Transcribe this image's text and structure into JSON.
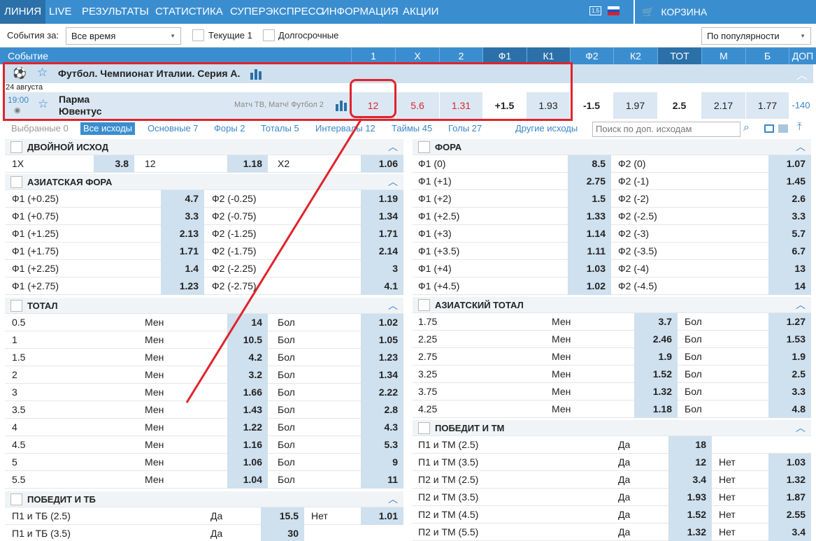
{
  "nav": {
    "items": [
      "ЛИНИЯ",
      "LIVE",
      "РЕЗУЛЬТАТЫ",
      "СТАТИСТИКА",
      "СУПЕРЭКСПРЕСС",
      "ИНФОРМАЦИЯ",
      "АКЦИИ"
    ],
    "lang": "1.5",
    "cart": "КОРЗИНА"
  },
  "filters": {
    "events_label": "События за:",
    "period": "Все время",
    "current": "Текущие 1",
    "longterm": "Долгосрочные",
    "sort": "По популярности"
  },
  "columns": [
    "Событие",
    "1",
    "X",
    "2",
    "Ф1",
    "К1",
    "Ф2",
    "К2",
    "ТОТ",
    "М",
    "Б",
    "ДОП"
  ],
  "league": "Футбол. Чемпионат Италии. Серия А.",
  "date": "24 августа",
  "match": {
    "time": "19:00",
    "team1": "Парма",
    "team2": "Ювентус",
    "tv": "Матч ТВ, Матч! Футбол 2",
    "odds": [
      "12",
      "5.6",
      "1.31",
      "+1.5",
      "1.93",
      "-1.5",
      "1.97",
      "2.5",
      "2.17",
      "1.77",
      "-140"
    ]
  },
  "tabs": [
    "Выбранные 0",
    "Все исходы",
    "Основные 7",
    "Форы 2",
    "Тоталы 5",
    "Интервалы 12",
    "Таймы 45",
    "Голы 27",
    "Другие исходы"
  ],
  "search_placeholder": "Поиск по доп. исходам",
  "markets": {
    "double": {
      "title": "ДВОЙНОЙ ИСХОД",
      "items": [
        [
          "1X",
          "3.8"
        ],
        [
          "12",
          "1.18"
        ],
        [
          "X2",
          "1.06"
        ]
      ]
    },
    "asian_hc": {
      "title": "АЗИАТСКАЯ ФОРА",
      "rows": [
        [
          "Ф1 (+0.25)",
          "4.7",
          "Ф2 (-0.25)",
          "1.19"
        ],
        [
          "Ф1 (+0.75)",
          "3.3",
          "Ф2 (-0.75)",
          "1.34"
        ],
        [
          "Ф1 (+1.25)",
          "2.13",
          "Ф2 (-1.25)",
          "1.71"
        ],
        [
          "Ф1 (+1.75)",
          "1.71",
          "Ф2 (-1.75)",
          "2.14"
        ],
        [
          "Ф1 (+2.25)",
          "1.4",
          "Ф2 (-2.25)",
          "3"
        ],
        [
          "Ф1 (+2.75)",
          "1.23",
          "Ф2 (-2.75)",
          "4.1"
        ]
      ]
    },
    "total": {
      "title": "ТОТАЛ",
      "under": "Мен",
      "over": "Бол",
      "rows": [
        [
          "0.5",
          "14",
          "1.02"
        ],
        [
          "1",
          "10.5",
          "1.05"
        ],
        [
          "1.5",
          "4.2",
          "1.23"
        ],
        [
          "2",
          "3.2",
          "1.34"
        ],
        [
          "3",
          "1.66",
          "2.22"
        ],
        [
          "3.5",
          "1.43",
          "2.8"
        ],
        [
          "4",
          "1.22",
          "4.3"
        ],
        [
          "4.5",
          "1.16",
          "5.3"
        ],
        [
          "5",
          "1.06",
          "9"
        ],
        [
          "5.5",
          "1.04",
          "11"
        ]
      ]
    },
    "win_tb": {
      "title": "ПОБЕДИТ И ТБ",
      "yes": "Да",
      "no": "Нет",
      "rows": [
        [
          "П1 и ТБ (2.5)",
          "15.5",
          "1.01"
        ],
        [
          "П1 и ТБ (3.5)",
          "30",
          ""
        ]
      ]
    },
    "handicap": {
      "title": "ФОРА",
      "rows": [
        [
          "Ф1 (0)",
          "8.5",
          "Ф2 (0)",
          "1.07"
        ],
        [
          "Ф1 (+1)",
          "2.75",
          "Ф2 (-1)",
          "1.45"
        ],
        [
          "Ф1 (+2)",
          "1.5",
          "Ф2 (-2)",
          "2.6"
        ],
        [
          "Ф1 (+2.5)",
          "1.33",
          "Ф2 (-2.5)",
          "3.3"
        ],
        [
          "Ф1 (+3)",
          "1.14",
          "Ф2 (-3)",
          "5.7"
        ],
        [
          "Ф1 (+3.5)",
          "1.11",
          "Ф2 (-3.5)",
          "6.7"
        ],
        [
          "Ф1 (+4)",
          "1.03",
          "Ф2 (-4)",
          "13"
        ],
        [
          "Ф1 (+4.5)",
          "1.02",
          "Ф2 (-4.5)",
          "14"
        ]
      ]
    },
    "asian_total": {
      "title": "АЗИАТСКИЙ ТОТАЛ",
      "under": "Мен",
      "over": "Бол",
      "rows": [
        [
          "1.75",
          "3.7",
          "1.27"
        ],
        [
          "2.25",
          "2.46",
          "1.53"
        ],
        [
          "2.75",
          "1.9",
          "1.9"
        ],
        [
          "3.25",
          "1.52",
          "2.5"
        ],
        [
          "3.75",
          "1.32",
          "3.3"
        ],
        [
          "4.25",
          "1.18",
          "4.8"
        ]
      ]
    },
    "win_tm": {
      "title": "ПОБЕДИТ И ТМ",
      "yes": "Да",
      "no": "Нет",
      "rows": [
        [
          "П1 и ТМ (2.5)",
          "18",
          ""
        ],
        [
          "П1 и ТМ (3.5)",
          "12",
          "1.03"
        ],
        [
          "П2 и ТМ (2.5)",
          "3.4",
          "1.32"
        ],
        [
          "П2 и ТМ (3.5)",
          "1.93",
          "1.87"
        ],
        [
          "П2 и ТМ (4.5)",
          "1.52",
          "2.55"
        ],
        [
          "П2 и ТМ (5.5)",
          "1.32",
          "3.4"
        ]
      ]
    }
  },
  "colors": {
    "nav": "#3a8ed0",
    "nav_dark": "#2b70a8",
    "odds_bg": "#cfe0ee",
    "link": "#3a86c9",
    "highlight": "#e0232b",
    "odds_red": "#e0232b"
  }
}
